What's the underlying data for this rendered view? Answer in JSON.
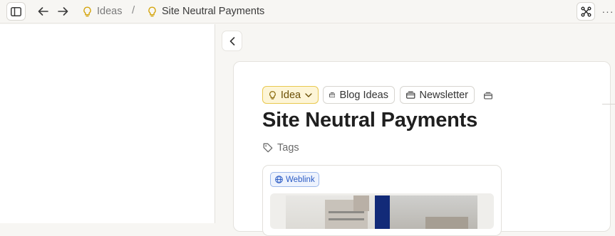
{
  "topbar": {
    "breadcrumb": [
      {
        "label": "Ideas",
        "icon": "lightbulb-icon"
      },
      {
        "label": "Site Neutral Payments",
        "icon": "lightbulb-icon"
      }
    ],
    "separator": "/",
    "more_label": "···"
  },
  "page": {
    "type_chip": {
      "label": "Idea",
      "icon": "lightbulb-icon",
      "color": "#e9c84f"
    },
    "collections": [
      {
        "label": "Blog Ideas",
        "icon": "collection-icon"
      },
      {
        "label": "Newsletter",
        "icon": "collection-icon"
      }
    ],
    "title": "Site Neutral Payments",
    "tags_label": "Tags",
    "weblink_badge": "Weblink"
  },
  "colors": {
    "accent_yellow": "#fdf5d7",
    "weblink_blue": "#2c5cc5",
    "background": "#f7f6f3"
  }
}
